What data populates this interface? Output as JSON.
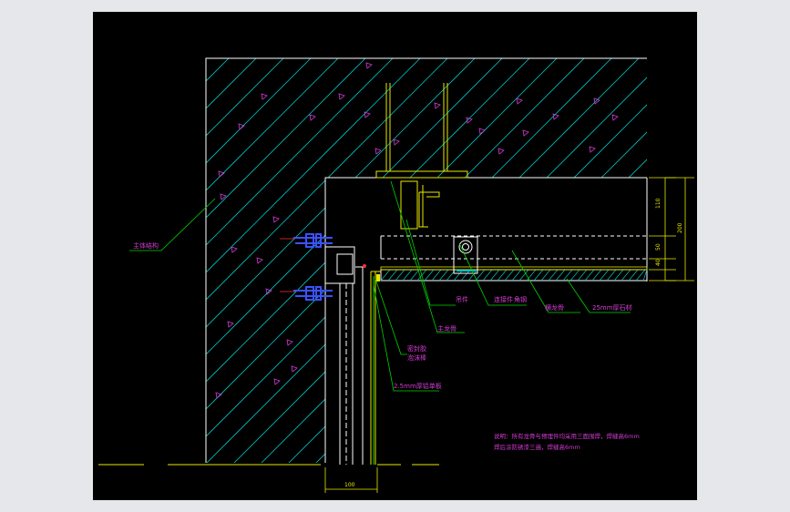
{
  "drawing": {
    "labels": {
      "main_structure": "主体结构",
      "keel_main": "主龙骨",
      "keel_cross": "横龙骨",
      "hanger": "吊件",
      "connector": "连接件",
      "steel_angle": "角钢",
      "adhesive": "密封胶",
      "foam_rod": "泡沫棒",
      "aluminum_plate": "2.5mm厚铝单板",
      "stone": "25mm厚石材"
    },
    "dimensions": {
      "d110": "110",
      "d200": "200",
      "d50": "50",
      "d40": "40",
      "d100": "100"
    },
    "note": {
      "line1": "说明：所有龙骨与预埋件均采用三面围焊，焊缝高6mm",
      "line2": "焊后涂防锈漆三遍，焊缝高6mm"
    },
    "colors": {
      "hatch": "#00c4c4",
      "outline": "#ffffff",
      "keel": "#e8e800",
      "leader": "#00d400",
      "text": "#d43cd4",
      "anchor": "#3a52ff",
      "dimension": "#e8e800"
    }
  }
}
